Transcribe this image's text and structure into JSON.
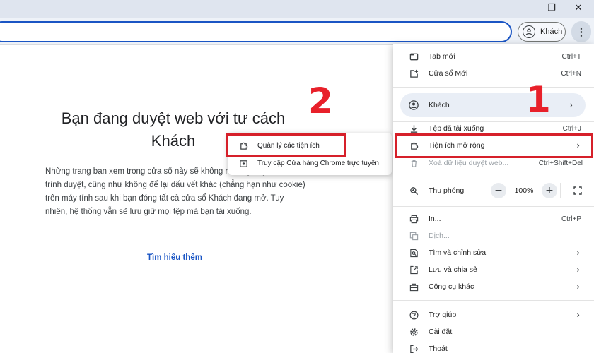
{
  "toolbar": {
    "guest_label": "Khách",
    "menu_button": "⋮"
  },
  "window": {
    "minimize": "—",
    "restore": "❐",
    "close": "✕"
  },
  "page": {
    "heading": "Bạn đang duyệt web với tư cách Khách",
    "body": "Những trang bạn xem trong cửa sổ này sẽ không nhật ký duyệt web của trình duyệt, cũng như không để lại dấu vết khác (chẳng hạn như cookie) trên máy tính sau khi bạn đóng tất cả cửa sổ Khách đang mở. Tuy nhiên, hệ thống vẫn sẽ lưu giữ mọi tệp mà bạn tải xuống.",
    "learn_more": "Tìm hiểu thêm"
  },
  "annotations": {
    "step1": "1",
    "step2": "2",
    "accent_color": "#d6202a"
  },
  "submenu": {
    "items": [
      {
        "label": "Quản lý các tiện ích",
        "icon": "puzzle-icon"
      },
      {
        "label": "Truy cập Cửa hàng Chrome trực tuyến",
        "icon": "store-icon"
      }
    ]
  },
  "menu": {
    "new_tab": {
      "label": "Tab mới",
      "shortcut": "Ctrl+T"
    },
    "new_window": {
      "label": "Cửa sổ Mới",
      "shortcut": "Ctrl+N"
    },
    "profile": {
      "label": "Khách"
    },
    "downloads": {
      "label": "Tệp đã tải xuống",
      "shortcut": "Ctrl+J"
    },
    "extensions": {
      "label": "Tiện ích mở rộng"
    },
    "clear_data": {
      "label": "Xoá dữ liệu duyệt web...",
      "shortcut": "Ctrl+Shift+Del"
    },
    "zoom": {
      "label": "Thu phóng",
      "minus": "−",
      "value": "100%",
      "plus": "+"
    },
    "print": {
      "label": "In...",
      "shortcut": "Ctrl+P"
    },
    "translate": {
      "label": "Dịch..."
    },
    "find_edit": {
      "label": "Tìm và chỉnh sửa"
    },
    "save_share": {
      "label": "Lưu và chia sẻ"
    },
    "more_tools": {
      "label": "Công cụ khác"
    },
    "help": {
      "label": "Trợ giúp"
    },
    "settings": {
      "label": "Cài đặt"
    },
    "exit": {
      "label": "Thoát"
    }
  }
}
